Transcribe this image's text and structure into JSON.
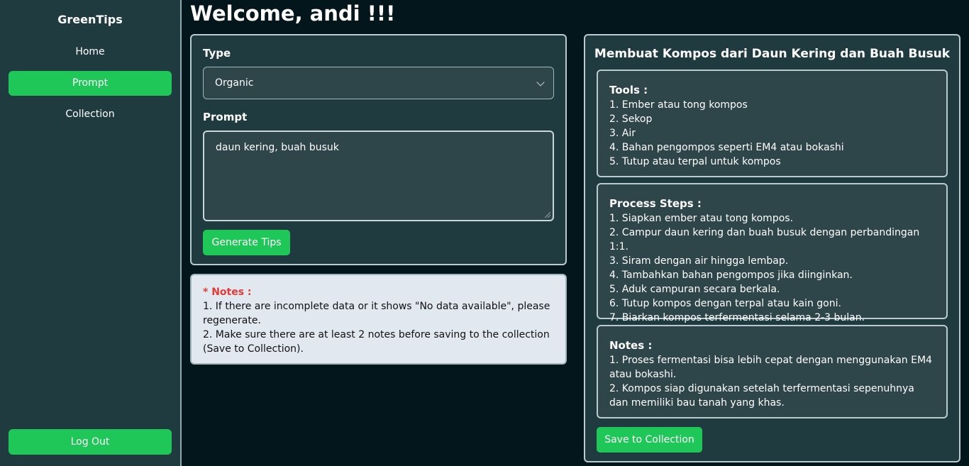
{
  "sidebar": {
    "brand": "GreenTips",
    "items": [
      {
        "label": "Home",
        "active": false
      },
      {
        "label": "Prompt",
        "active": true
      },
      {
        "label": "Collection",
        "active": false
      }
    ],
    "logout_label": "Log Out"
  },
  "main": {
    "welcome": "Welcome, andi !!!",
    "form": {
      "type_label": "Type",
      "type_value": "Organic",
      "prompt_label": "Prompt",
      "prompt_value": "daun kering, buah busuk",
      "generate_label": "Generate Tips"
    },
    "notes": {
      "title": "* Notes :",
      "lines": [
        "1. If there are incomplete data or it shows \"No data available\", please regenerate.",
        "2. Make sure there are at least 2 notes before saving to the collection (Save to Collection)."
      ]
    }
  },
  "result": {
    "title": "Membuat Kompos dari Daun Kering dan Buah Busuk",
    "tools": {
      "title": "Tools :",
      "items": [
        "1. Ember atau tong kompos",
        "2. Sekop",
        "3. Air",
        "4. Bahan pengompos seperti EM4 atau bokashi",
        "5. Tutup atau terpal untuk kompos"
      ]
    },
    "steps": {
      "title": "Process Steps :",
      "items": [
        "1. Siapkan ember atau tong kompos.",
        "2. Campur daun kering dan buah busuk dengan perbandingan 1:1.",
        "3. Siram dengan air hingga lembap.",
        "4. Tambahkan bahan pengompos jika diinginkan.",
        "5. Aduk campuran secara berkala.",
        "6. Tutup kompos dengan terpal atau kain goni.",
        "7. Biarkan kompos terfermentasi selama 2-3 bulan."
      ]
    },
    "notes": {
      "title": "Notes :",
      "items": [
        "1. Proses fermentasi bisa lebih cepat dengan menggunakan EM4 atau bokashi.",
        "2. Kompos siap digunakan setelah terfermentasi sepenuhnya dan memiliki bau tanah yang khas."
      ]
    },
    "save_label": "Save to Collection"
  },
  "colors": {
    "accent": "#1fc758",
    "background": "#02161b",
    "panel": "#1f3b40",
    "notes_title": "#e53935"
  }
}
